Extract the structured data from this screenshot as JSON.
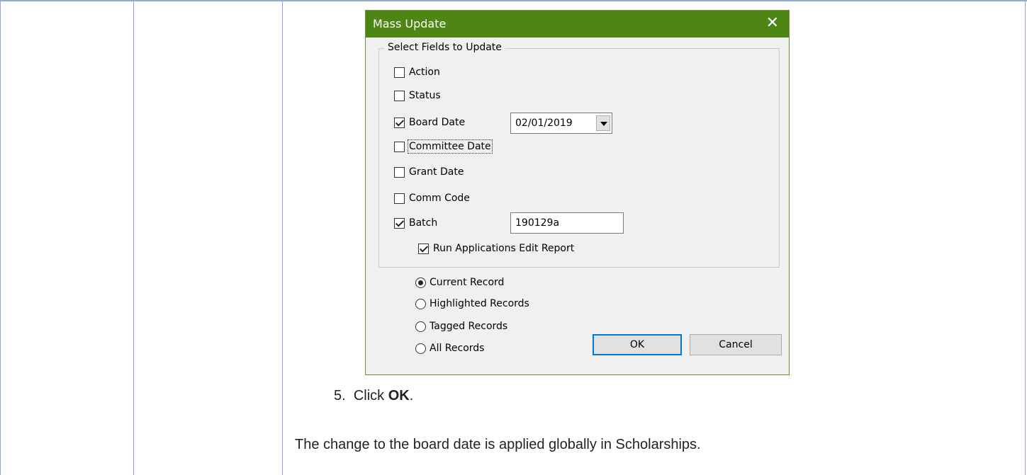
{
  "dialog": {
    "title": "Mass Update",
    "close_label": "✕",
    "group_label": "Select Fields to Update",
    "fields": [
      {
        "label": "Action",
        "checked": false
      },
      {
        "label": "Status",
        "checked": false
      },
      {
        "label": "Board Date",
        "checked": true
      },
      {
        "label": "Committee Date",
        "checked": false
      },
      {
        "label": "Grant Date",
        "checked": false
      },
      {
        "label": "Comm Code",
        "checked": false
      },
      {
        "label": "Batch",
        "checked": true
      }
    ],
    "board_date_value": "02/01/2019",
    "batch_value": "190129a",
    "run_report": {
      "label": "Run Applications Edit Report",
      "checked": true
    },
    "scope_options": [
      {
        "label": "Current Record",
        "selected": true
      },
      {
        "label": "Highlighted Records",
        "selected": false
      },
      {
        "label": "Tagged Records",
        "selected": false
      },
      {
        "label": "All Records",
        "selected": false
      }
    ],
    "ok_label": "OK",
    "cancel_label": "Cancel"
  },
  "doc": {
    "step_number": "5.",
    "step_prefix": "Click ",
    "step_bold": "OK",
    "step_suffix": ".",
    "result_text": "The change to the board date is applied globally in Scholarships."
  }
}
